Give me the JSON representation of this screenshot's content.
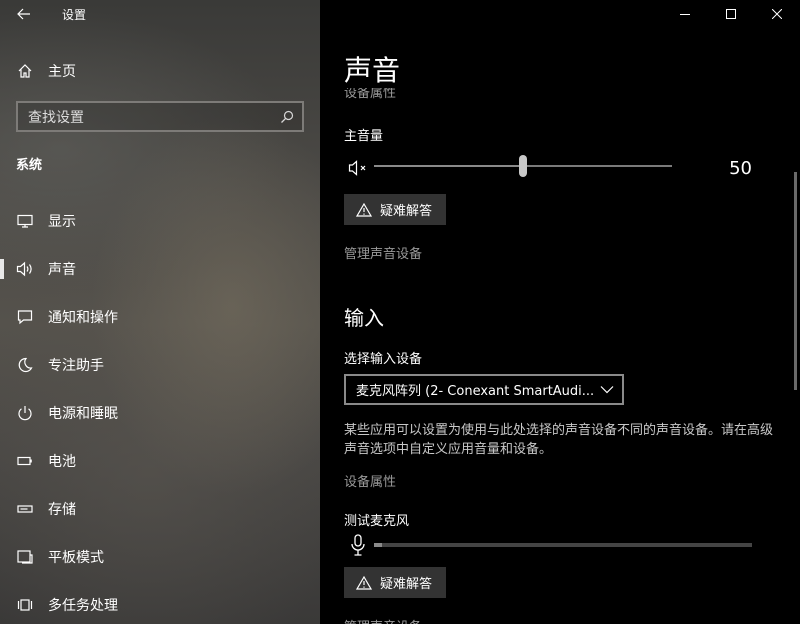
{
  "window": {
    "title": "设置",
    "controls": [
      "minimize-icon",
      "maximize-icon",
      "close-icon"
    ]
  },
  "sidebar": {
    "home_label": "主页",
    "search_placeholder": "查找设置",
    "section_title": "系统",
    "items": [
      {
        "label": "显示",
        "icon": "display-icon",
        "active": false
      },
      {
        "label": "声音",
        "icon": "speaker-icon",
        "active": true
      },
      {
        "label": "通知和操作",
        "icon": "notification-icon",
        "active": false
      },
      {
        "label": "专注助手",
        "icon": "moon-icon",
        "active": false
      },
      {
        "label": "电源和睡眠",
        "icon": "power-icon",
        "active": false
      },
      {
        "label": "电池",
        "icon": "battery-icon",
        "active": false
      },
      {
        "label": "存储",
        "icon": "storage-icon",
        "active": false
      },
      {
        "label": "平板模式",
        "icon": "tablet-icon",
        "active": false
      },
      {
        "label": "多任务处理",
        "icon": "multitask-icon",
        "active": false
      }
    ]
  },
  "main": {
    "page_title": "声音",
    "output_props_link": "设备属性",
    "master_volume": {
      "label": "主音量",
      "value": 50,
      "value_text": "50",
      "icon": "speaker-muted-icon"
    },
    "troubleshoot_label": "疑难解答",
    "manage_devices_link": "管理声音设备",
    "input": {
      "heading": "输入",
      "select_label": "选择输入设备",
      "selected_device": "麦克风阵列 (2- Conexant SmartAudi...",
      "description": "某些应用可以设置为使用与此处选择的声音设备不同的声音设备。请在高级声音选项中自定义应用音量和设备。",
      "device_props_link": "设备属性",
      "test_mic_label": "测试麦克风",
      "mic_level": 0.02,
      "troubleshoot_label": "疑难解答",
      "manage_devices_link": "管理声音设备"
    }
  },
  "colors": {
    "right_pane_bg": "#000000",
    "button_bg": "#333333",
    "muted_text": "#9a9a9a"
  }
}
